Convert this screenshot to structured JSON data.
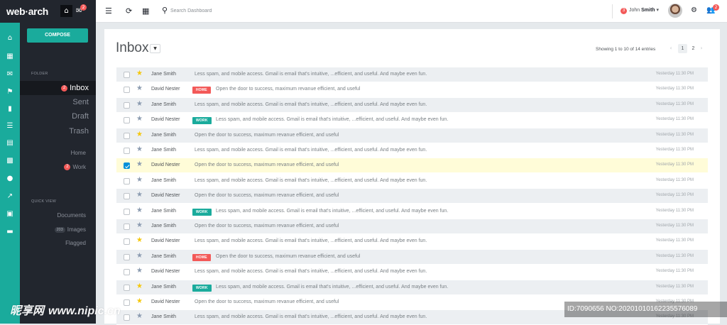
{
  "brand": {
    "logo": "web·arch",
    "notif_count": "2"
  },
  "topbar": {
    "search_placeholder": "Search Dashboard",
    "user_badge": "3",
    "user_first": "John",
    "user_last": "Smith",
    "people_badge": "2"
  },
  "sidebar": {
    "compose": "COMPOSE",
    "folder_label": "FOLDER",
    "folders": [
      {
        "label": "Inbox",
        "badge": "2"
      },
      {
        "label": "Sent"
      },
      {
        "label": "Draft"
      },
      {
        "label": "Trash"
      }
    ],
    "tags": [
      {
        "label": "Home"
      },
      {
        "label": "Work",
        "badge": "2"
      }
    ],
    "quick_label": "QUICK VIEW",
    "quick": [
      {
        "label": "Documents"
      },
      {
        "label": "Images",
        "badge": "203"
      },
      {
        "label": "Flagged"
      }
    ]
  },
  "main": {
    "title": "Inbox",
    "entries": "Showing 1 to 10 of 14 entries",
    "pages": [
      "1",
      "2"
    ],
    "rows": [
      {
        "starred": true,
        "sender": "Jane Smith",
        "tag": "",
        "message": "Less spam, and mobile access. Gmail is email that's intuitive, ...efficient, and useful. And maybe even fun.",
        "time": "Yesterday 11:30 PM",
        "checked": false
      },
      {
        "starred": false,
        "sender": "David Nester",
        "tag": "HOME",
        "message": "Open the door to success, maximum revanue efficient, and useful",
        "time": "Yesterday 11:30 PM",
        "checked": false
      },
      {
        "starred": false,
        "sender": "Jane Smith",
        "tag": "",
        "message": "Less spam, and mobile access. Gmail is email that's intuitive, ...efficient, and useful. And maybe even fun.",
        "time": "Yesterday 11:30 PM",
        "checked": false
      },
      {
        "starred": false,
        "sender": "David Nester",
        "tag": "WORK",
        "message": "Less spam, and mobile access. Gmail is email that's intuitive, ...efficient, and useful. And maybe even fun.",
        "time": "Yesterday 11:30 PM",
        "checked": false
      },
      {
        "starred": true,
        "sender": "Jane Smith",
        "tag": "",
        "message": "Open the door to success, maximum revanue efficient, and useful",
        "time": "Yesterday 11:30 PM",
        "checked": false
      },
      {
        "starred": false,
        "sender": "Jane Smith",
        "tag": "",
        "message": "Less spam, and mobile access. Gmail is email that's intuitive, ...efficient, and useful. And maybe even fun.",
        "time": "Yesterday 11:30 PM",
        "checked": false
      },
      {
        "starred": false,
        "sender": "David Nester",
        "tag": "",
        "message": "Open the door to success, maximum revanue efficient, and useful",
        "time": "Yesterday 11:30 PM",
        "checked": true
      },
      {
        "starred": false,
        "sender": "Jane Smith",
        "tag": "",
        "message": "Less spam, and mobile access. Gmail is email that's intuitive, ...efficient, and useful. And maybe even fun.",
        "time": "Yesterday 11:30 PM",
        "checked": false
      },
      {
        "starred": false,
        "sender": "David Nester",
        "tag": "",
        "message": "Open the door to success, maximum revanue efficient, and useful",
        "time": "Yesterday 11:30 PM",
        "checked": false
      },
      {
        "starred": false,
        "sender": "Jane Smith",
        "tag": "WORK",
        "message": "Less spam, and mobile access. Gmail is email that's intuitive, ...efficient, and useful. And maybe even fun.",
        "time": "Yesterday 11:30 PM",
        "checked": false
      },
      {
        "starred": false,
        "sender": "Jane Smith",
        "tag": "",
        "message": "Open the door to success, maximum revanue efficient, and useful",
        "time": "Yesterday 11:30 PM",
        "checked": false
      },
      {
        "starred": true,
        "sender": "David Nester",
        "tag": "",
        "message": "Less spam, and mobile access. Gmail is email that's intuitive, ...efficient, and useful. And maybe even fun.",
        "time": "Yesterday 11:30 PM",
        "checked": false
      },
      {
        "starred": false,
        "sender": "Jane Smith",
        "tag": "HOME",
        "message": "Open the door to success, maximum revanue efficient, and useful",
        "time": "Yesterday 11:30 PM",
        "checked": false
      },
      {
        "starred": false,
        "sender": "David Nester",
        "tag": "",
        "message": "Less spam, and mobile access. Gmail is email that's intuitive, ...efficient, and useful. And maybe even fun.",
        "time": "Yesterday 11:30 PM",
        "checked": false
      },
      {
        "starred": true,
        "sender": "Jane Smith",
        "tag": "WORK",
        "message": "Less spam, and mobile access. Gmail is email that's intuitive, ...efficient, and useful. And maybe even fun.",
        "time": "Yesterday 11:30 PM",
        "checked": false
      },
      {
        "starred": true,
        "sender": "David Nester",
        "tag": "",
        "message": "Open the door to success, maximum revanue efficient, and useful",
        "time": "Yesterday 11:30 PM",
        "checked": false
      },
      {
        "starred": false,
        "sender": "Jane Smith",
        "tag": "",
        "message": "Less spam, and mobile access. Gmail is email that's intuitive, ...efficient, and useful. And maybe even fun.",
        "time": "Yesterday 11:30 PM",
        "checked": false
      }
    ]
  },
  "watermark": {
    "left": "昵享网",
    "left_url": "www.nipic.cn",
    "right": "ID:7090656 NO:20201010162235576089"
  },
  "colors": {
    "accent": "#1aab9c",
    "sidebar": "#22262e",
    "badge": "#f35958",
    "selected_row": "#fffcd8",
    "star": "#f5c70a"
  }
}
